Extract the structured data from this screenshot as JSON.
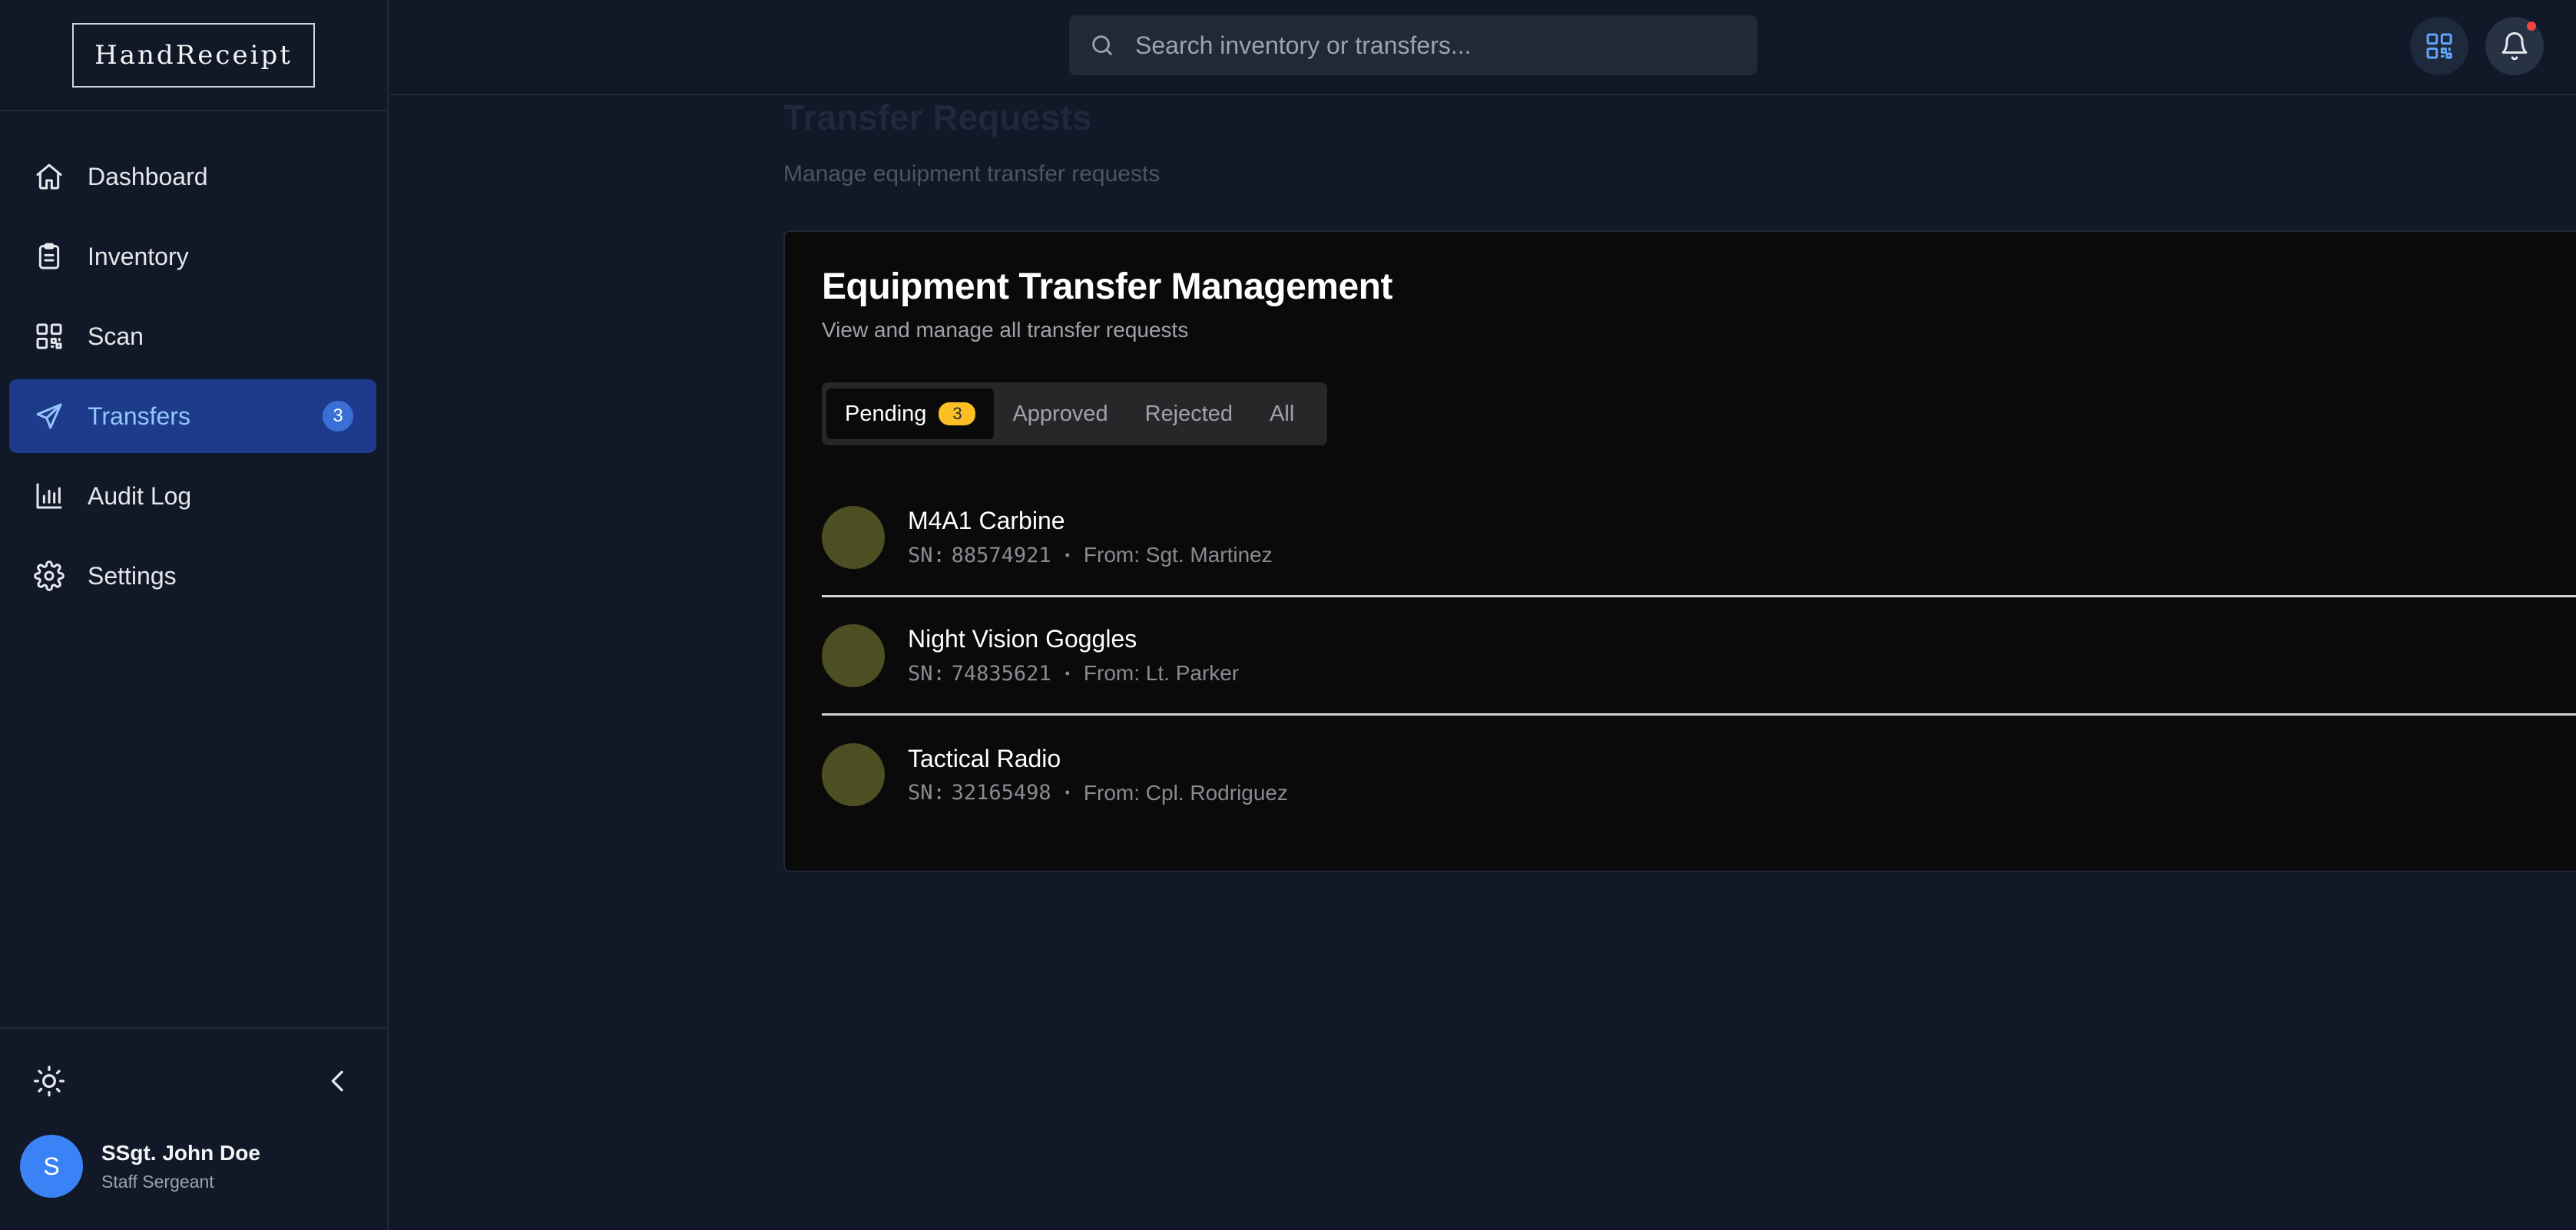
{
  "app": {
    "brand": "HandReceipt"
  },
  "sidebar": {
    "items": [
      {
        "label": "Dashboard",
        "icon": "home-icon"
      },
      {
        "label": "Inventory",
        "icon": "clipboard-icon"
      },
      {
        "label": "Scan",
        "icon": "qr-code-icon"
      },
      {
        "label": "Transfers",
        "icon": "send-icon",
        "badge": "3",
        "active": true
      },
      {
        "label": "Audit Log",
        "icon": "bar-chart-icon"
      },
      {
        "label": "Settings",
        "icon": "gear-icon"
      }
    ],
    "user": {
      "initial": "S",
      "name": "SSgt. John Doe",
      "role": "Staff Sergeant"
    }
  },
  "header": {
    "search_placeholder": "Search inventory or transfers...",
    "has_notification": true
  },
  "page": {
    "title": "Transfer Requests",
    "subtitle": "Manage equipment transfer requests"
  },
  "card": {
    "title": "Equipment Transfer Management",
    "description": "View and manage all transfer requests",
    "tabs": [
      {
        "label": "Pending",
        "count": "3",
        "active": true
      },
      {
        "label": "Approved"
      },
      {
        "label": "Rejected"
      },
      {
        "label": "All"
      }
    ],
    "transfers": [
      {
        "name": "M4A1 Carbine",
        "sn_label": "SN:",
        "sn": "88574921",
        "from": "From: Sgt. Martinez"
      },
      {
        "name": "Night Vision Goggles",
        "sn_label": "SN:",
        "sn": "74835621",
        "from": "From: Lt. Parker"
      },
      {
        "name": "Tactical Radio",
        "sn_label": "SN:",
        "sn": "32165498",
        "from": "From: Cpl. Rodriguez"
      }
    ],
    "separator": "•"
  },
  "colors": {
    "accent": "#3b82f6",
    "active_nav_bg": "#1e3a8a",
    "pending_badge": "#fbbf24",
    "notification_dot": "#ef4444"
  }
}
